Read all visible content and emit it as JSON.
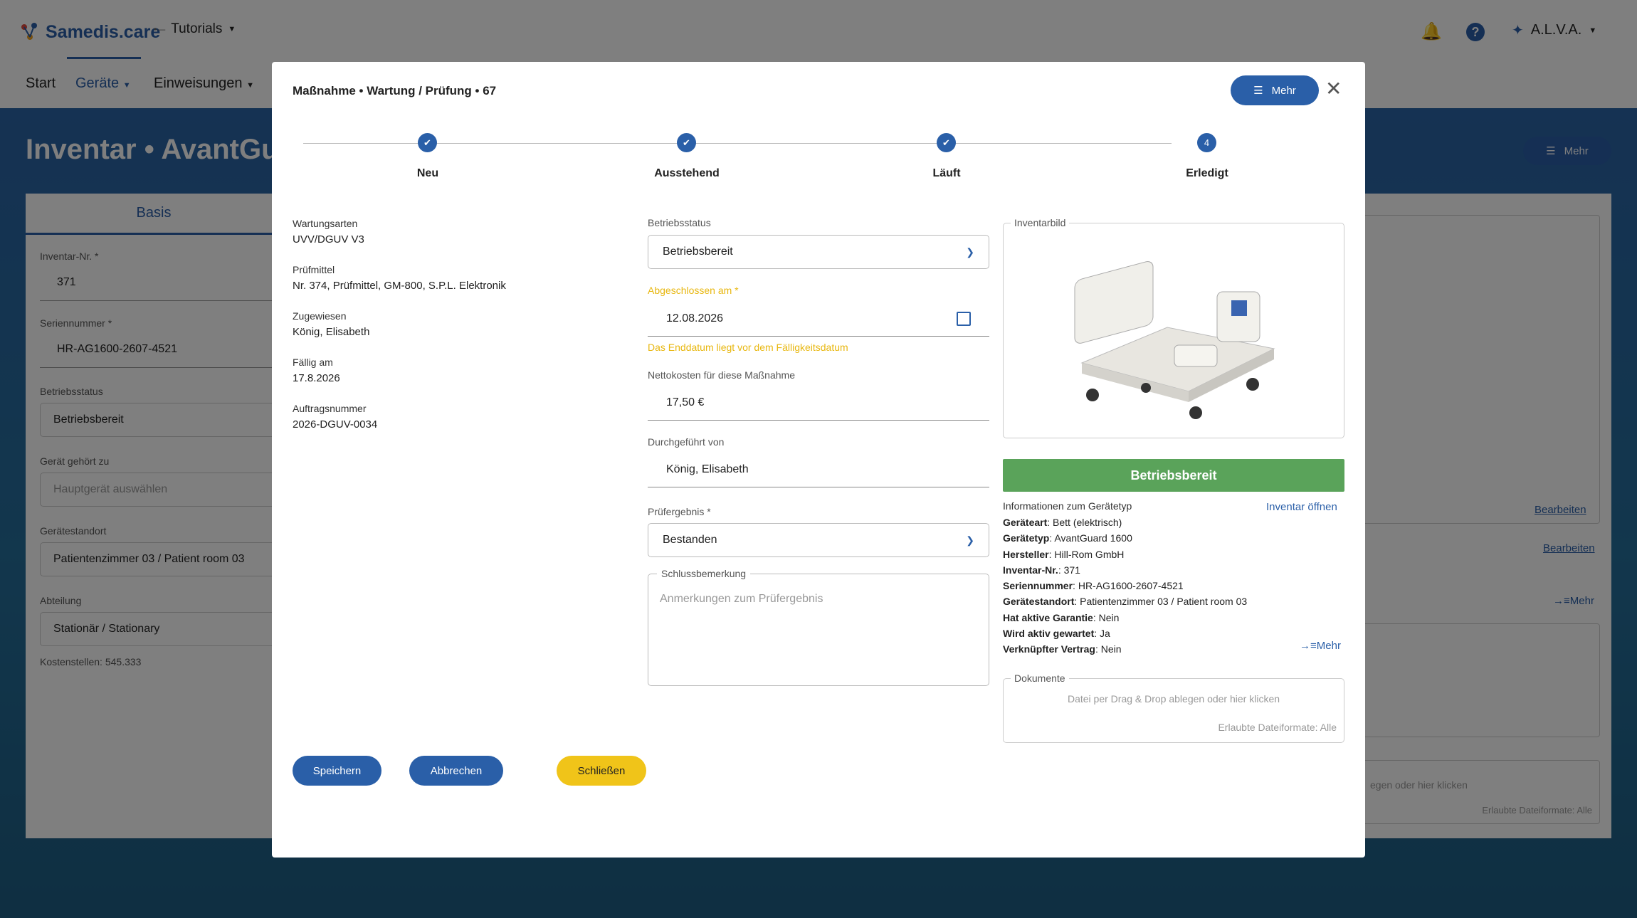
{
  "app": {
    "logo_text": "Samedis.care",
    "tutorials_label": "Tutorials",
    "user_label": "A.L.V.A.",
    "nav": [
      "Start",
      "Geräte",
      "Einweisungen"
    ]
  },
  "background_page": {
    "title": "Inventar • AvantGuard",
    "mehr_label": "Mehr",
    "tab_basis": "Basis",
    "fields": [
      {
        "label": "Inventar-Nr. *",
        "value": "371"
      },
      {
        "label": "Seriennummer *",
        "value": "HR-AG1600-2607-4521"
      },
      {
        "label": "Betriebsstatus",
        "value": "Betriebsbereit"
      },
      {
        "label": "Gerät gehört zu",
        "value": "Hauptgerät auswählen"
      },
      {
        "label": "Gerätestandort",
        "value": "Patientenzimmer 03 / Patient room 03"
      },
      {
        "label": "Abteilung",
        "value": "Stationär / Stationary"
      }
    ],
    "kostenstellen": "Kostenstellen: 545.333",
    "bearbeiten_1": "Bearbeiten",
    "bearbeiten_2": "Bearbeiten",
    "mehr_link": "Mehr",
    "drop_text": "egen oder hier klicken",
    "formats_text": "Erlaubte Dateiformate: Alle"
  },
  "modal": {
    "title": "Maßnahme • Wartung / Prüfung • 67",
    "mehr_label": "Mehr",
    "steps": [
      {
        "label": "Neu",
        "state": "done"
      },
      {
        "label": "Ausstehend",
        "state": "done"
      },
      {
        "label": "Läuft",
        "state": "done"
      },
      {
        "label": "Erledigt",
        "state": "current",
        "number": "4"
      }
    ],
    "info": [
      {
        "label": "Wartungsarten",
        "value": "UVV/DGUV V3"
      },
      {
        "label": "Prüfmittel",
        "value": "Nr. 374, Prüfmittel, GM-800, S.P.L. Elektronik"
      },
      {
        "label": "Zugewiesen",
        "value": "König, Elisabeth"
      },
      {
        "label": "Fällig am",
        "value": "17.8.2026"
      },
      {
        "label": "Auftragsnummer",
        "value": "2026-DGUV-0034"
      }
    ],
    "form": {
      "betriebsstatus_label": "Betriebsstatus",
      "betriebsstatus_value": "Betriebsbereit",
      "abgeschlossen_label": "Abgeschlossen am *",
      "abgeschlossen_value": "12.08.2026",
      "abgeschlossen_warning": "Das Enddatum liegt vor dem Fälligkeitsdatum",
      "netto_label": "Nettokosten für diese Maßnahme",
      "netto_value": "17,50 €",
      "durchgefuehrt_label": "Durchgeführt von",
      "durchgefuehrt_value": "König, Elisabeth",
      "ergebnis_label": "Prüfergebnis *",
      "ergebnis_value": "Bestanden",
      "schluss_label": "Schlussbemerkung",
      "schluss_placeholder": "Anmerkungen zum Prüfergebnis"
    },
    "right": {
      "inventarbild_label": "Inventarbild",
      "status_banner": "Betriebsbereit",
      "info_title": "Informationen zum Gerätetyp",
      "inventar_oeffnen": "Inventar öffnen",
      "details": [
        {
          "k": "Geräteart",
          "v": "Bett (elektrisch)"
        },
        {
          "k": "Gerätetyp",
          "v": "AvantGuard 1600"
        },
        {
          "k": "Hersteller",
          "v": "Hill-Rom GmbH"
        },
        {
          "k": "Inventar-Nr.",
          "v": "371"
        },
        {
          "k": "Seriennummer",
          "v": "HR-AG1600-2607-4521"
        },
        {
          "k": "Gerätestandort",
          "v": "Patientenzimmer 03 / Patient room 03"
        },
        {
          "k": "Hat aktive Garantie",
          "v": "Nein"
        },
        {
          "k": "Wird aktiv gewartet",
          "v": "Ja"
        },
        {
          "k": "Verknüpfter Vertrag",
          "v": "Nein"
        }
      ],
      "mehr_link": "Mehr",
      "dokumente_label": "Dokumente",
      "drop_text": "Datei per Drag & Drop ablegen oder hier klicken",
      "formats_text": "Erlaubte Dateiformate: Alle"
    },
    "buttons": {
      "speichern": "Speichern",
      "abbrechen": "Abbrechen",
      "schliessen": "Schließen"
    }
  },
  "colors": {
    "primary": "#2a5fa8",
    "success": "#5aa35a",
    "warning": "#f0c419",
    "warning_text": "#e8b70f"
  }
}
